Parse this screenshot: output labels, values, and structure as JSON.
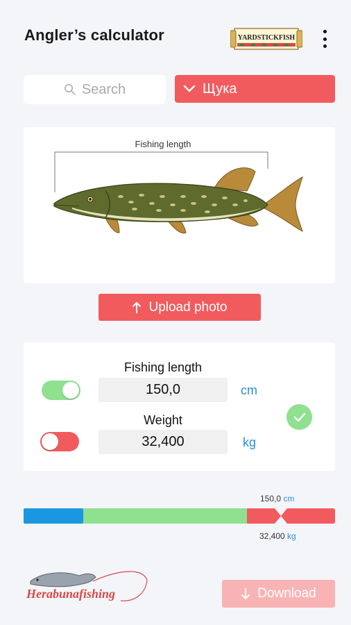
{
  "header": {
    "title": "Angler’s calculator",
    "logo_text": "YARDSTICKFISH"
  },
  "search": {
    "placeholder": "Search"
  },
  "species": {
    "selected": "Щука"
  },
  "photo": {
    "length_label": "Fishing length"
  },
  "upload": {
    "label": "Upload photo"
  },
  "calculator": {
    "length_label": "Fishing length",
    "length_value": "150,0",
    "length_unit": "cm",
    "length_toggle_on": true,
    "weight_label": "Weight",
    "weight_value": "32,400",
    "weight_unit": "kg",
    "weight_toggle_on": false
  },
  "scale": {
    "length_value": "150,0",
    "length_unit": "cm",
    "weight_value": "32,400",
    "weight_unit": "kg",
    "segments": [
      {
        "color": "#1b96e1"
      },
      {
        "color": "#8fe08f"
      },
      {
        "color": "#f25b5e"
      }
    ]
  },
  "footer": {
    "brand_text": "Herabunafishing",
    "download_label": "Download"
  },
  "colors": {
    "accent_red": "#f25b5e",
    "accent_green": "#8fe08f",
    "accent_blue": "#2a8fd6",
    "download_disabled": "#f8b4b5"
  }
}
